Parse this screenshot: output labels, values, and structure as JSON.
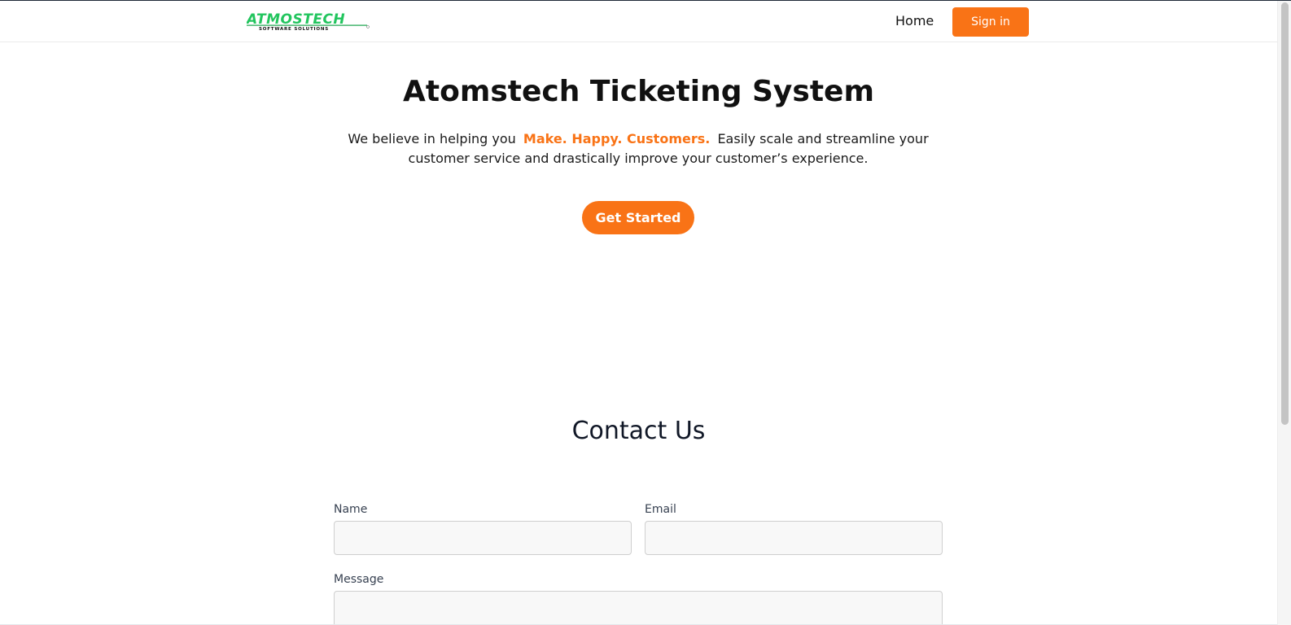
{
  "header": {
    "logo": {
      "brand": "ATMOSTECH",
      "tagline": "SOFTWARE SOLUTIONS",
      "brand_color": "#22c55e"
    },
    "nav_home": "Home",
    "signin_label": "Sign in"
  },
  "hero": {
    "title": "Atomstech Ticketing System",
    "text_before": "We believe in helping you",
    "highlight": "Make. Happy. Customers.",
    "text_after": "Easily scale and streamline your customer service and drastically improve your customer’s experience.",
    "cta_label": "Get Started"
  },
  "contact": {
    "title": "Contact Us",
    "name_label": "Name",
    "email_label": "Email",
    "message_label": "Message",
    "name_value": "",
    "email_value": "",
    "message_value": ""
  },
  "colors": {
    "accent": "#f97316",
    "text": "#111827",
    "input_bg": "#f8f8f8",
    "input_border": "#cfcfcf"
  }
}
